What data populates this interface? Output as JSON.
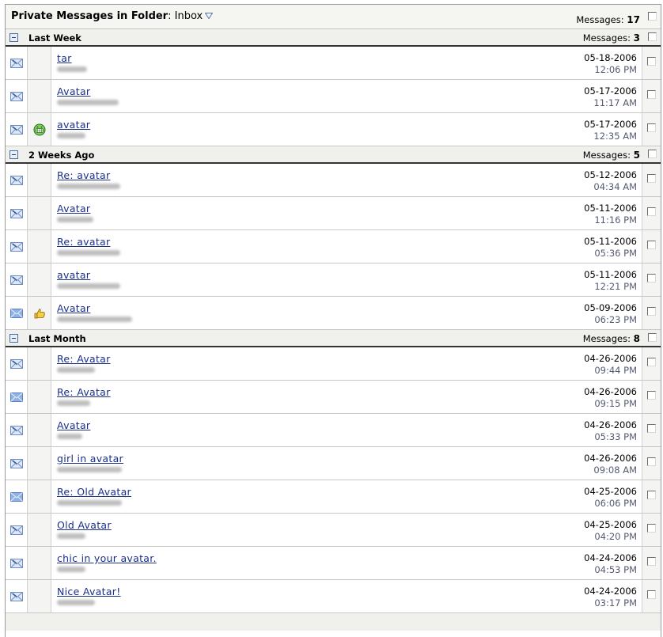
{
  "header": {
    "title": "Private Messages in Folder",
    "colon": ":",
    "folder": "Inbox",
    "messages_label": "Messages:",
    "messages_count": "17"
  },
  "groups": [
    {
      "title": "Last Week",
      "messages_label": "Messages:",
      "count": "3",
      "rows": [
        {
          "subject": "tar",
          "date": "05-18-2006",
          "time": "12:06 PM",
          "icon": "envelope-read-icon",
          "emoticon": ""
        },
        {
          "subject": "Avatar",
          "date": "05-17-2006",
          "time": "11:17 AM",
          "icon": "envelope-read-icon",
          "emoticon": ""
        },
        {
          "subject": "avatar",
          "date": "05-17-2006",
          "time": "12:35 AM",
          "icon": "envelope-read-icon",
          "emoticon": "grin-icon"
        }
      ]
    },
    {
      "title": "2 Weeks Ago",
      "messages_label": "Messages:",
      "count": "5",
      "rows": [
        {
          "subject": "Re: avatar",
          "date": "05-12-2006",
          "time": "04:34 AM",
          "icon": "envelope-read-icon",
          "emoticon": ""
        },
        {
          "subject": "Avatar",
          "date": "05-11-2006",
          "time": "11:16 PM",
          "icon": "envelope-read-icon",
          "emoticon": ""
        },
        {
          "subject": "Re: avatar",
          "date": "05-11-2006",
          "time": "05:36 PM",
          "icon": "envelope-read-icon",
          "emoticon": ""
        },
        {
          "subject": "avatar",
          "date": "05-11-2006",
          "time": "12:21 PM",
          "icon": "envelope-read-icon",
          "emoticon": ""
        },
        {
          "subject": "Avatar",
          "date": "05-09-2006",
          "time": "06:23 PM",
          "icon": "envelope-replied-icon",
          "emoticon": "thumbs-up-icon"
        }
      ]
    },
    {
      "title": "Last Month",
      "messages_label": "Messages:",
      "count": "8",
      "rows": [
        {
          "subject": "Re: Avatar",
          "date": "04-26-2006",
          "time": "09:44 PM",
          "icon": "envelope-read-icon",
          "emoticon": ""
        },
        {
          "subject": "Re: Avatar",
          "date": "04-26-2006",
          "time": "09:15 PM",
          "icon": "envelope-replied-icon",
          "emoticon": ""
        },
        {
          "subject": "Avatar",
          "date": "04-26-2006",
          "time": "05:33 PM",
          "icon": "envelope-read-icon",
          "emoticon": ""
        },
        {
          "subject": "girl in avatar",
          "date": "04-26-2006",
          "time": "09:08 AM",
          "icon": "envelope-read-icon",
          "emoticon": ""
        },
        {
          "subject": "Re: Old Avatar",
          "date": "04-25-2006",
          "time": "06:06 PM",
          "icon": "envelope-replied-icon",
          "emoticon": ""
        },
        {
          "subject": "Old Avatar",
          "date": "04-25-2006",
          "time": "04:20 PM",
          "icon": "envelope-read-icon",
          "emoticon": ""
        },
        {
          "subject": "chic in your avatar.",
          "date": "04-24-2006",
          "time": "04:53 PM",
          "icon": "envelope-read-icon",
          "emoticon": ""
        },
        {
          "subject": "Nice Avatar!",
          "date": "04-24-2006",
          "time": "03:17 PM",
          "icon": "envelope-read-icon",
          "emoticon": ""
        }
      ]
    }
  ],
  "colors": {
    "link": "#1a2f8a",
    "time": "#555a70",
    "envelope": "#7da2d8"
  }
}
